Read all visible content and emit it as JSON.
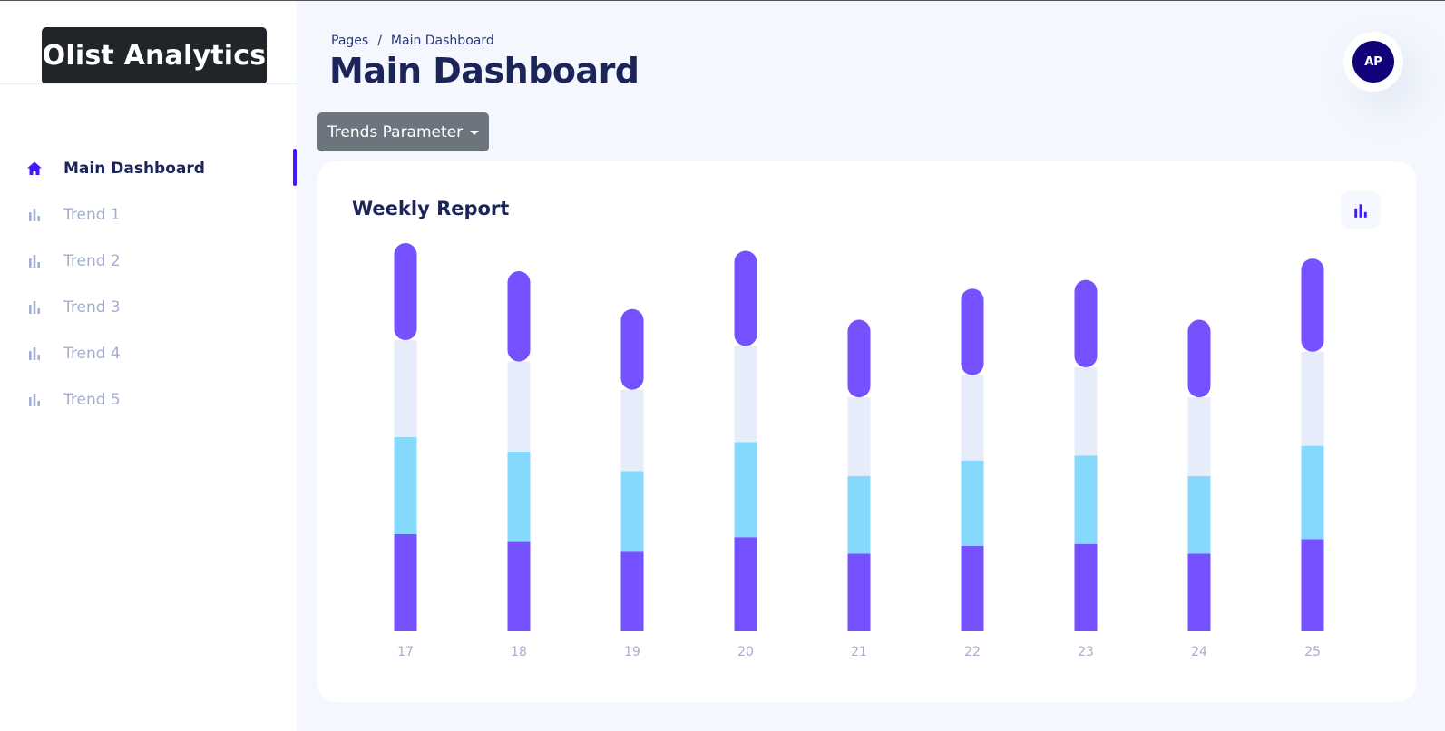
{
  "app": {
    "brand": "Olist Analytics"
  },
  "sidebar": {
    "items": [
      {
        "label": "Main Dashboard",
        "icon": "home-icon",
        "active": true
      },
      {
        "label": "Trend 1",
        "icon": "bar-chart-icon",
        "active": false
      },
      {
        "label": "Trend 2",
        "icon": "bar-chart-icon",
        "active": false
      },
      {
        "label": "Trend 3",
        "icon": "bar-chart-icon",
        "active": false
      },
      {
        "label": "Trend 4",
        "icon": "bar-chart-icon",
        "active": false
      },
      {
        "label": "Trend 5",
        "icon": "bar-chart-icon",
        "active": false
      }
    ]
  },
  "header": {
    "breadcrumb": [
      "Pages",
      "Main Dashboard"
    ],
    "breadcrumb_sep": "/",
    "title": "Main Dashboard",
    "avatar_initials": "AP"
  },
  "controls": {
    "trends_button": "Trends Parameter"
  },
  "card": {
    "title": "Weekly Report",
    "icon": "bar-chart-icon"
  },
  "colors": {
    "accent": "#4318ff",
    "series_purple": "#7551ff",
    "series_cyan": "#84d9fd",
    "series_light": "#e6ecfa",
    "navy": "#1b2559",
    "muted": "#a3aed0"
  },
  "chart_data": {
    "type": "bar",
    "stacked": true,
    "categories": [
      "17",
      "18",
      "19",
      "20",
      "21",
      "22",
      "23",
      "24",
      "25"
    ],
    "series": [
      {
        "values": [
          100,
          92,
          82,
          97,
          80,
          88,
          90,
          80,
          95
        ],
        "color": "#7551ff"
      },
      {
        "values": [
          100,
          93,
          83,
          98,
          80,
          88,
          91,
          80,
          96
        ],
        "color": "#84d9fd"
      },
      {
        "values": [
          100,
          93,
          84,
          99,
          81,
          88,
          91,
          81,
          97
        ],
        "color": "#e6ecfa"
      },
      {
        "values": [
          100,
          93,
          83,
          98,
          80,
          89,
          90,
          80,
          96
        ],
        "color": "#7551ff"
      }
    ],
    "title": "Weekly Report",
    "xlabel": "",
    "ylabel": "",
    "ylim": [
      0,
      400
    ],
    "grid": false,
    "legend": "none"
  }
}
